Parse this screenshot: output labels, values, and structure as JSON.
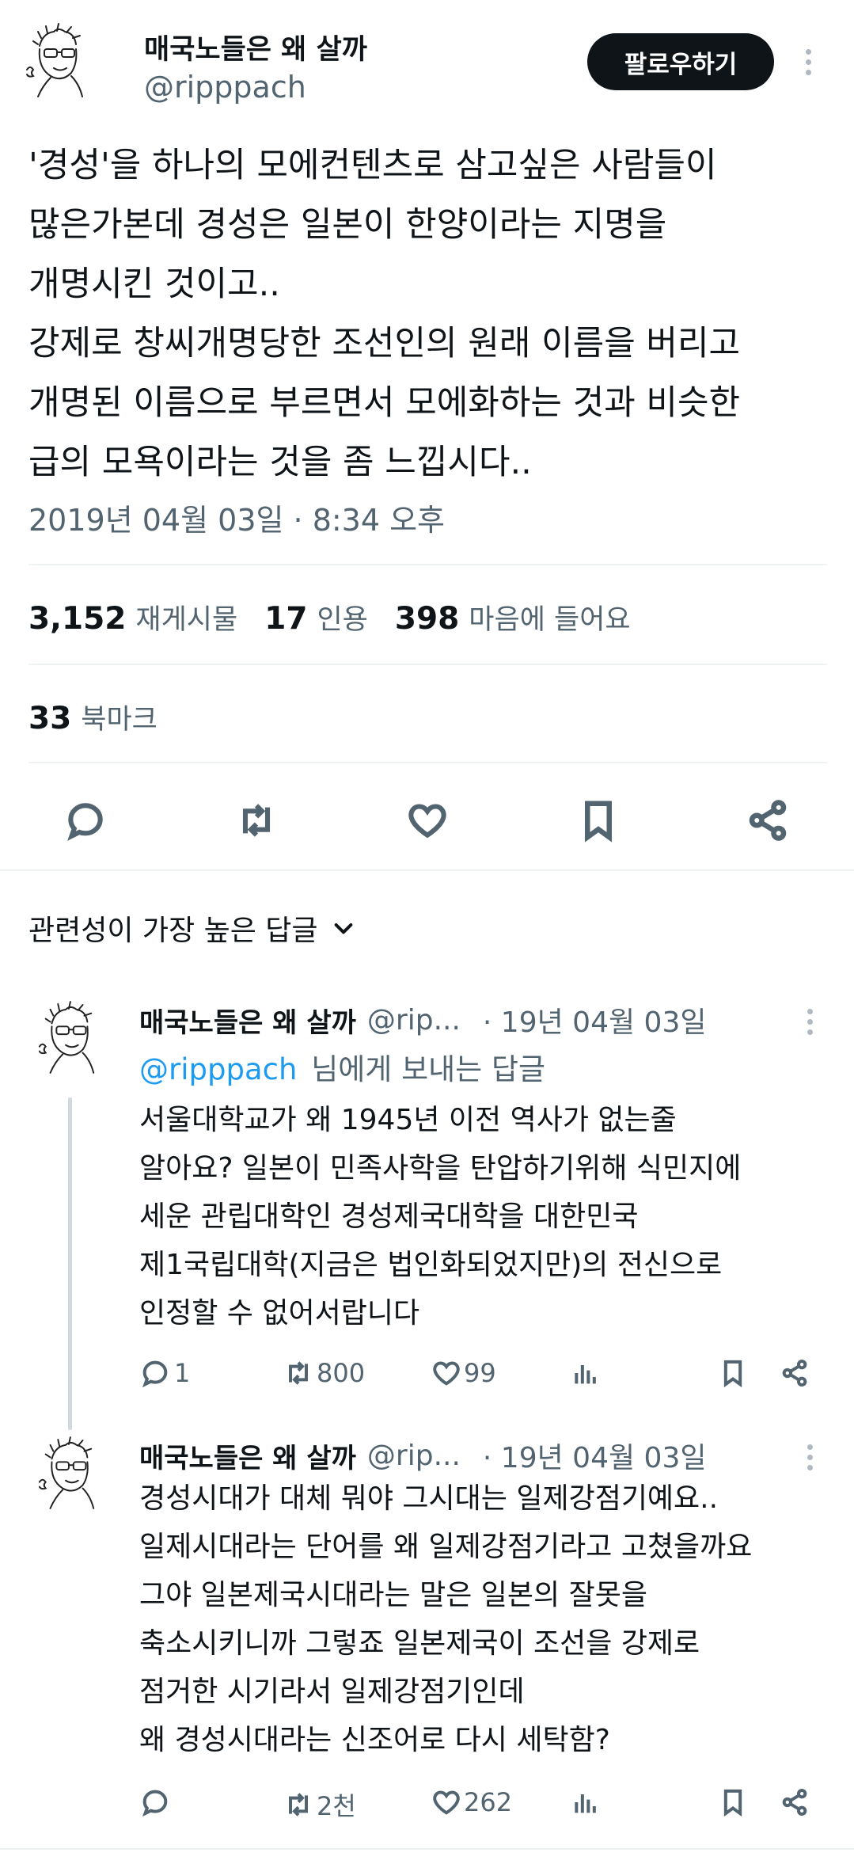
{
  "tweet": {
    "display_name": "매국노들은 왜 살까",
    "handle": "@ripppach",
    "follow_label": "팔로우하기",
    "lines": [
      "'경성'을 하나의 모에컨텐츠로 삼고싶은 사람들이",
      "많은가본데 경성은 일본이 한양이라는 지명을",
      "개명시킨 것이고..",
      "강제로 창씨개명당한 조선인의 원래 이름을 버리고",
      "개명된 이름으로 부르면서 모에화하는 것과 비슷한",
      "급의 모욕이라는 것을 좀 느낍시다.."
    ],
    "timestamp": "2019년 04월 03일 · 8:34 오후",
    "stats": {
      "retweets_count": "3,152",
      "retweets_label": "재게시물",
      "quotes_count": "17",
      "quotes_label": "인용",
      "likes_count": "398",
      "likes_label": "마음에 들어요",
      "bookmarks_count": "33",
      "bookmarks_label": "북마크"
    },
    "actions": [
      "reply-icon",
      "retweet-icon",
      "heart-icon",
      "bookmark-icon",
      "share-icon"
    ]
  },
  "replies_sort": {
    "label": "관련성이 가장 높은 답글"
  },
  "replies": [
    {
      "display_name": "매국노들은 왜 살까",
      "handle": "@rip...",
      "date": "· 19년 04월 03일",
      "replying_to_handle": "@ripppach",
      "replying_to_suffix": "님에게 보내는 답글",
      "lines": [
        "서울대학교가 왜 1945년 이전 역사가 없는줄",
        "알아요? 일본이 민족사학을 탄압하기위해 식민지에",
        "세운 관립대학인 경성제국대학을 대한민국",
        "제1국립대학(지금은 법인화되었지만)의 전신으로",
        "인정할 수 없어서랍니다"
      ],
      "reply_count": "1",
      "retweet_count": "800",
      "like_count": "99"
    },
    {
      "display_name": "매국노들은 왜 살까",
      "handle": "@rip...",
      "date": "· 19년 04월 03일",
      "lines": [
        "경성시대가 대체 뭐야 그시대는 일제강점기예요..",
        "일제시대라는 단어를 왜 일제강점기라고 고쳤을까요",
        "그야 일본제국시대라는 말은 일본의 잘못을",
        "축소시키니까 그렇죠 일본제국이 조선을 강제로",
        "점거한 시기라서 일제강점기인데",
        "왜 경성시대라는 신조어로 다시 세탁함?"
      ],
      "reply_count": "",
      "retweet_count": "2천",
      "like_count": "262"
    }
  ]
}
